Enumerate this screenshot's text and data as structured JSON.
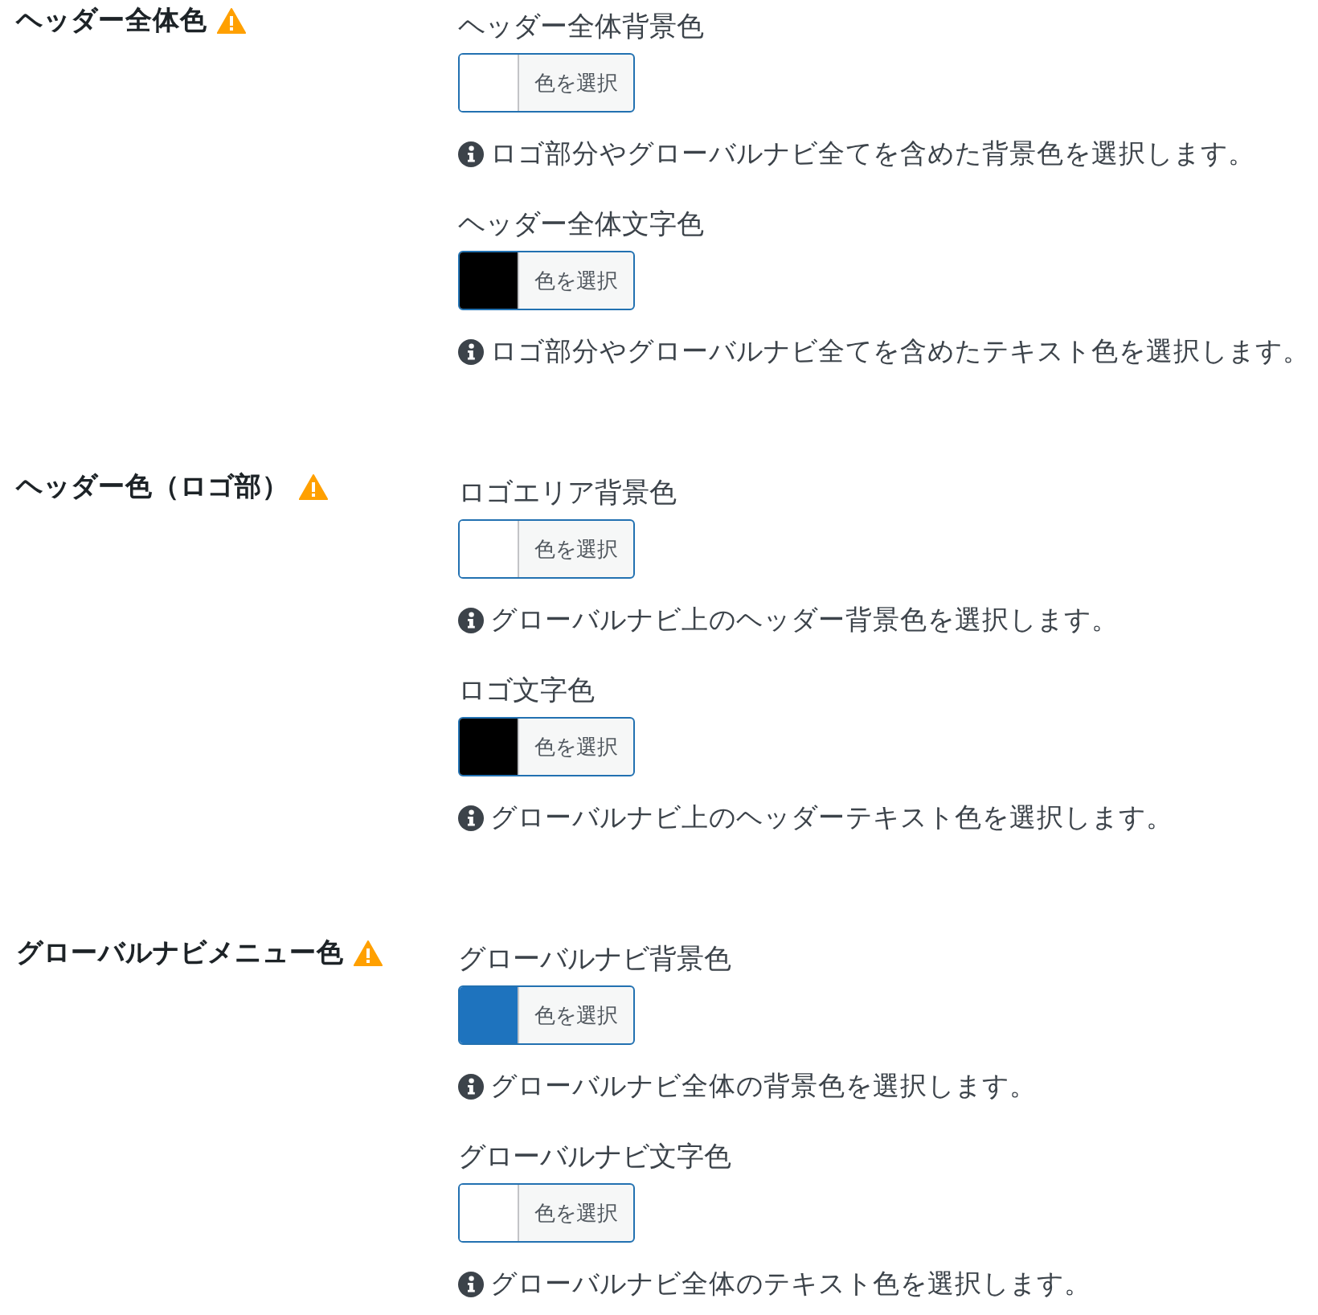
{
  "sections": [
    {
      "title": "ヘッダー全体色",
      "fields": [
        {
          "label": "ヘッダー全体背景色",
          "color": "#ffffff",
          "button": "色を選択",
          "description": "ロゴ部分やグローバルナビ全てを含めた背景色を選択します。"
        },
        {
          "label": "ヘッダー全体文字色",
          "color": "#000000",
          "button": "色を選択",
          "description": "ロゴ部分やグローバルナビ全てを含めたテキスト色を選択します。"
        }
      ]
    },
    {
      "title": "ヘッダー色（ロゴ部）",
      "fields": [
        {
          "label": "ロゴエリア背景色",
          "color": "#ffffff",
          "button": "色を選択",
          "description": "グローバルナビ上のヘッダー背景色を選択します。"
        },
        {
          "label": "ロゴ文字色",
          "color": "#000000",
          "button": "色を選択",
          "description": "グローバルナビ上のヘッダーテキスト色を選択します。"
        }
      ]
    },
    {
      "title": "グローバルナビメニュー色",
      "fields": [
        {
          "label": "グローバルナビ背景色",
          "color": "#1e73be",
          "button": "色を選択",
          "description": "グローバルナビ全体の背景色を選択します。"
        },
        {
          "label": "グローバルナビ文字色",
          "color": "#ffffff",
          "button": "色を選択",
          "description": "グローバルナビ全体のテキスト色を選択します。"
        }
      ]
    }
  ]
}
